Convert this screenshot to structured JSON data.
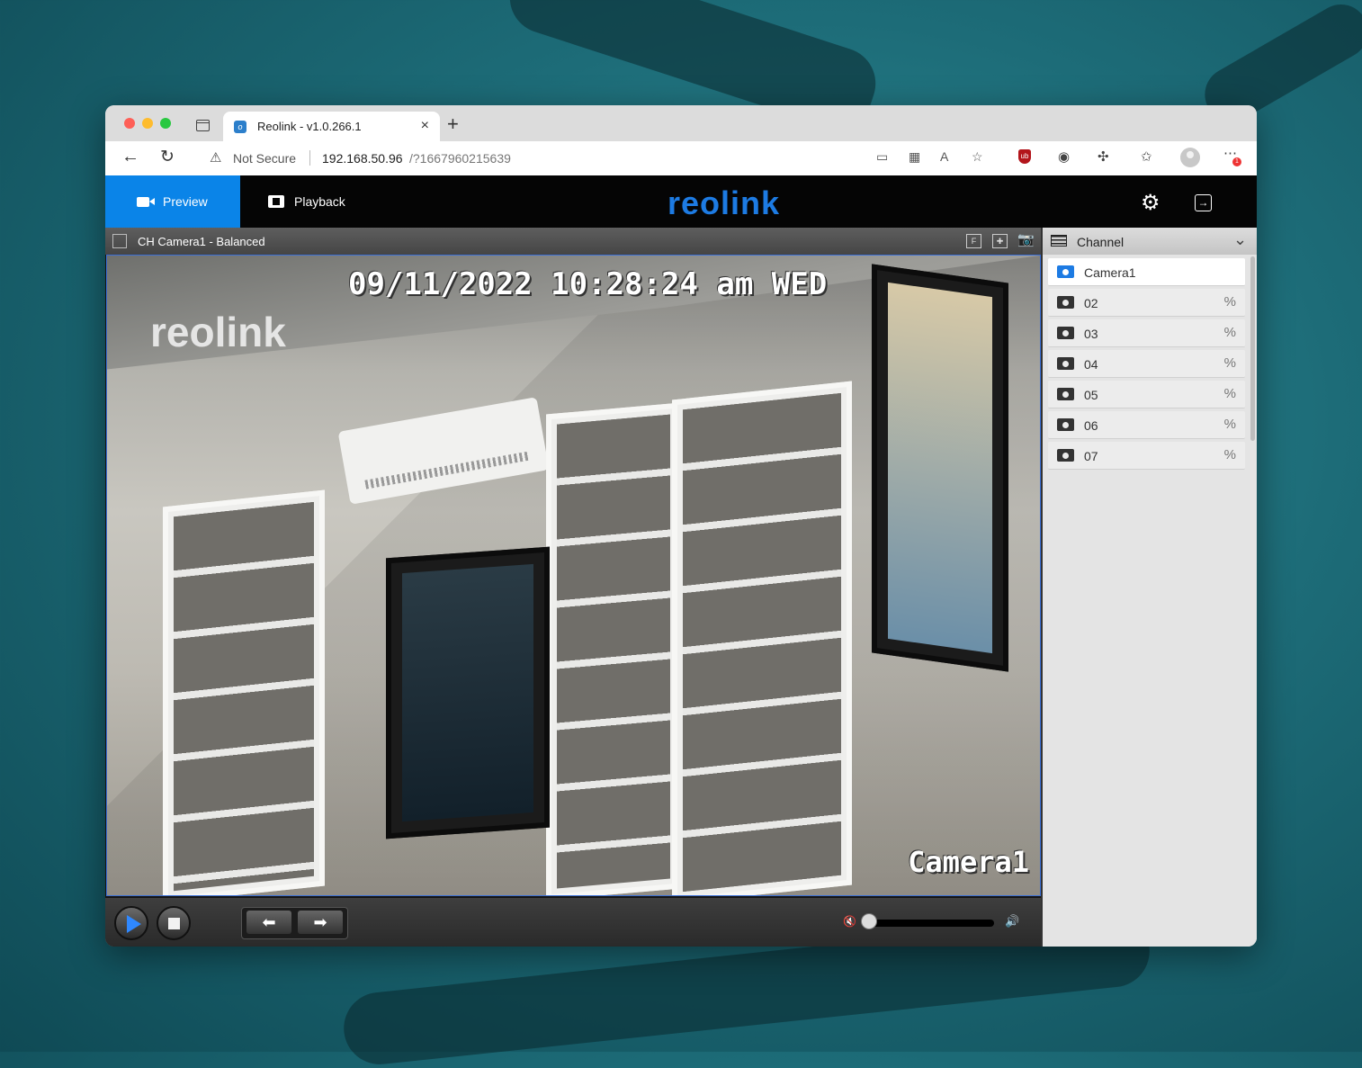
{
  "browser": {
    "tab_title": "Reolink - v1.0.266.1",
    "favicon_letter": "o",
    "security_label": "Not Secure",
    "url_host": "192.168.50.96",
    "url_path": "/?1667960215639",
    "extension_badge": "1"
  },
  "app": {
    "nav": {
      "preview_label": "Preview",
      "playback_label": "Playback"
    },
    "logo_text": "reolink"
  },
  "video": {
    "title": "CH Camera1 - Balanced",
    "osd_timestamp": "09/11/2022 10:28:24 am WED",
    "osd_watermark": "reolink",
    "osd_camera_name": "Camera1",
    "volume_level": 0.0
  },
  "channels": {
    "title": "Channel",
    "items": [
      {
        "label": "Camera1",
        "active": true
      },
      {
        "label": "02",
        "active": false
      },
      {
        "label": "03",
        "active": false
      },
      {
        "label": "04",
        "active": false
      },
      {
        "label": "05",
        "active": false
      },
      {
        "label": "06",
        "active": false
      },
      {
        "label": "07",
        "active": false
      }
    ]
  },
  "colors": {
    "accent": "#0a84e8",
    "logo": "#1d7be3",
    "header_bg": "#050505"
  }
}
